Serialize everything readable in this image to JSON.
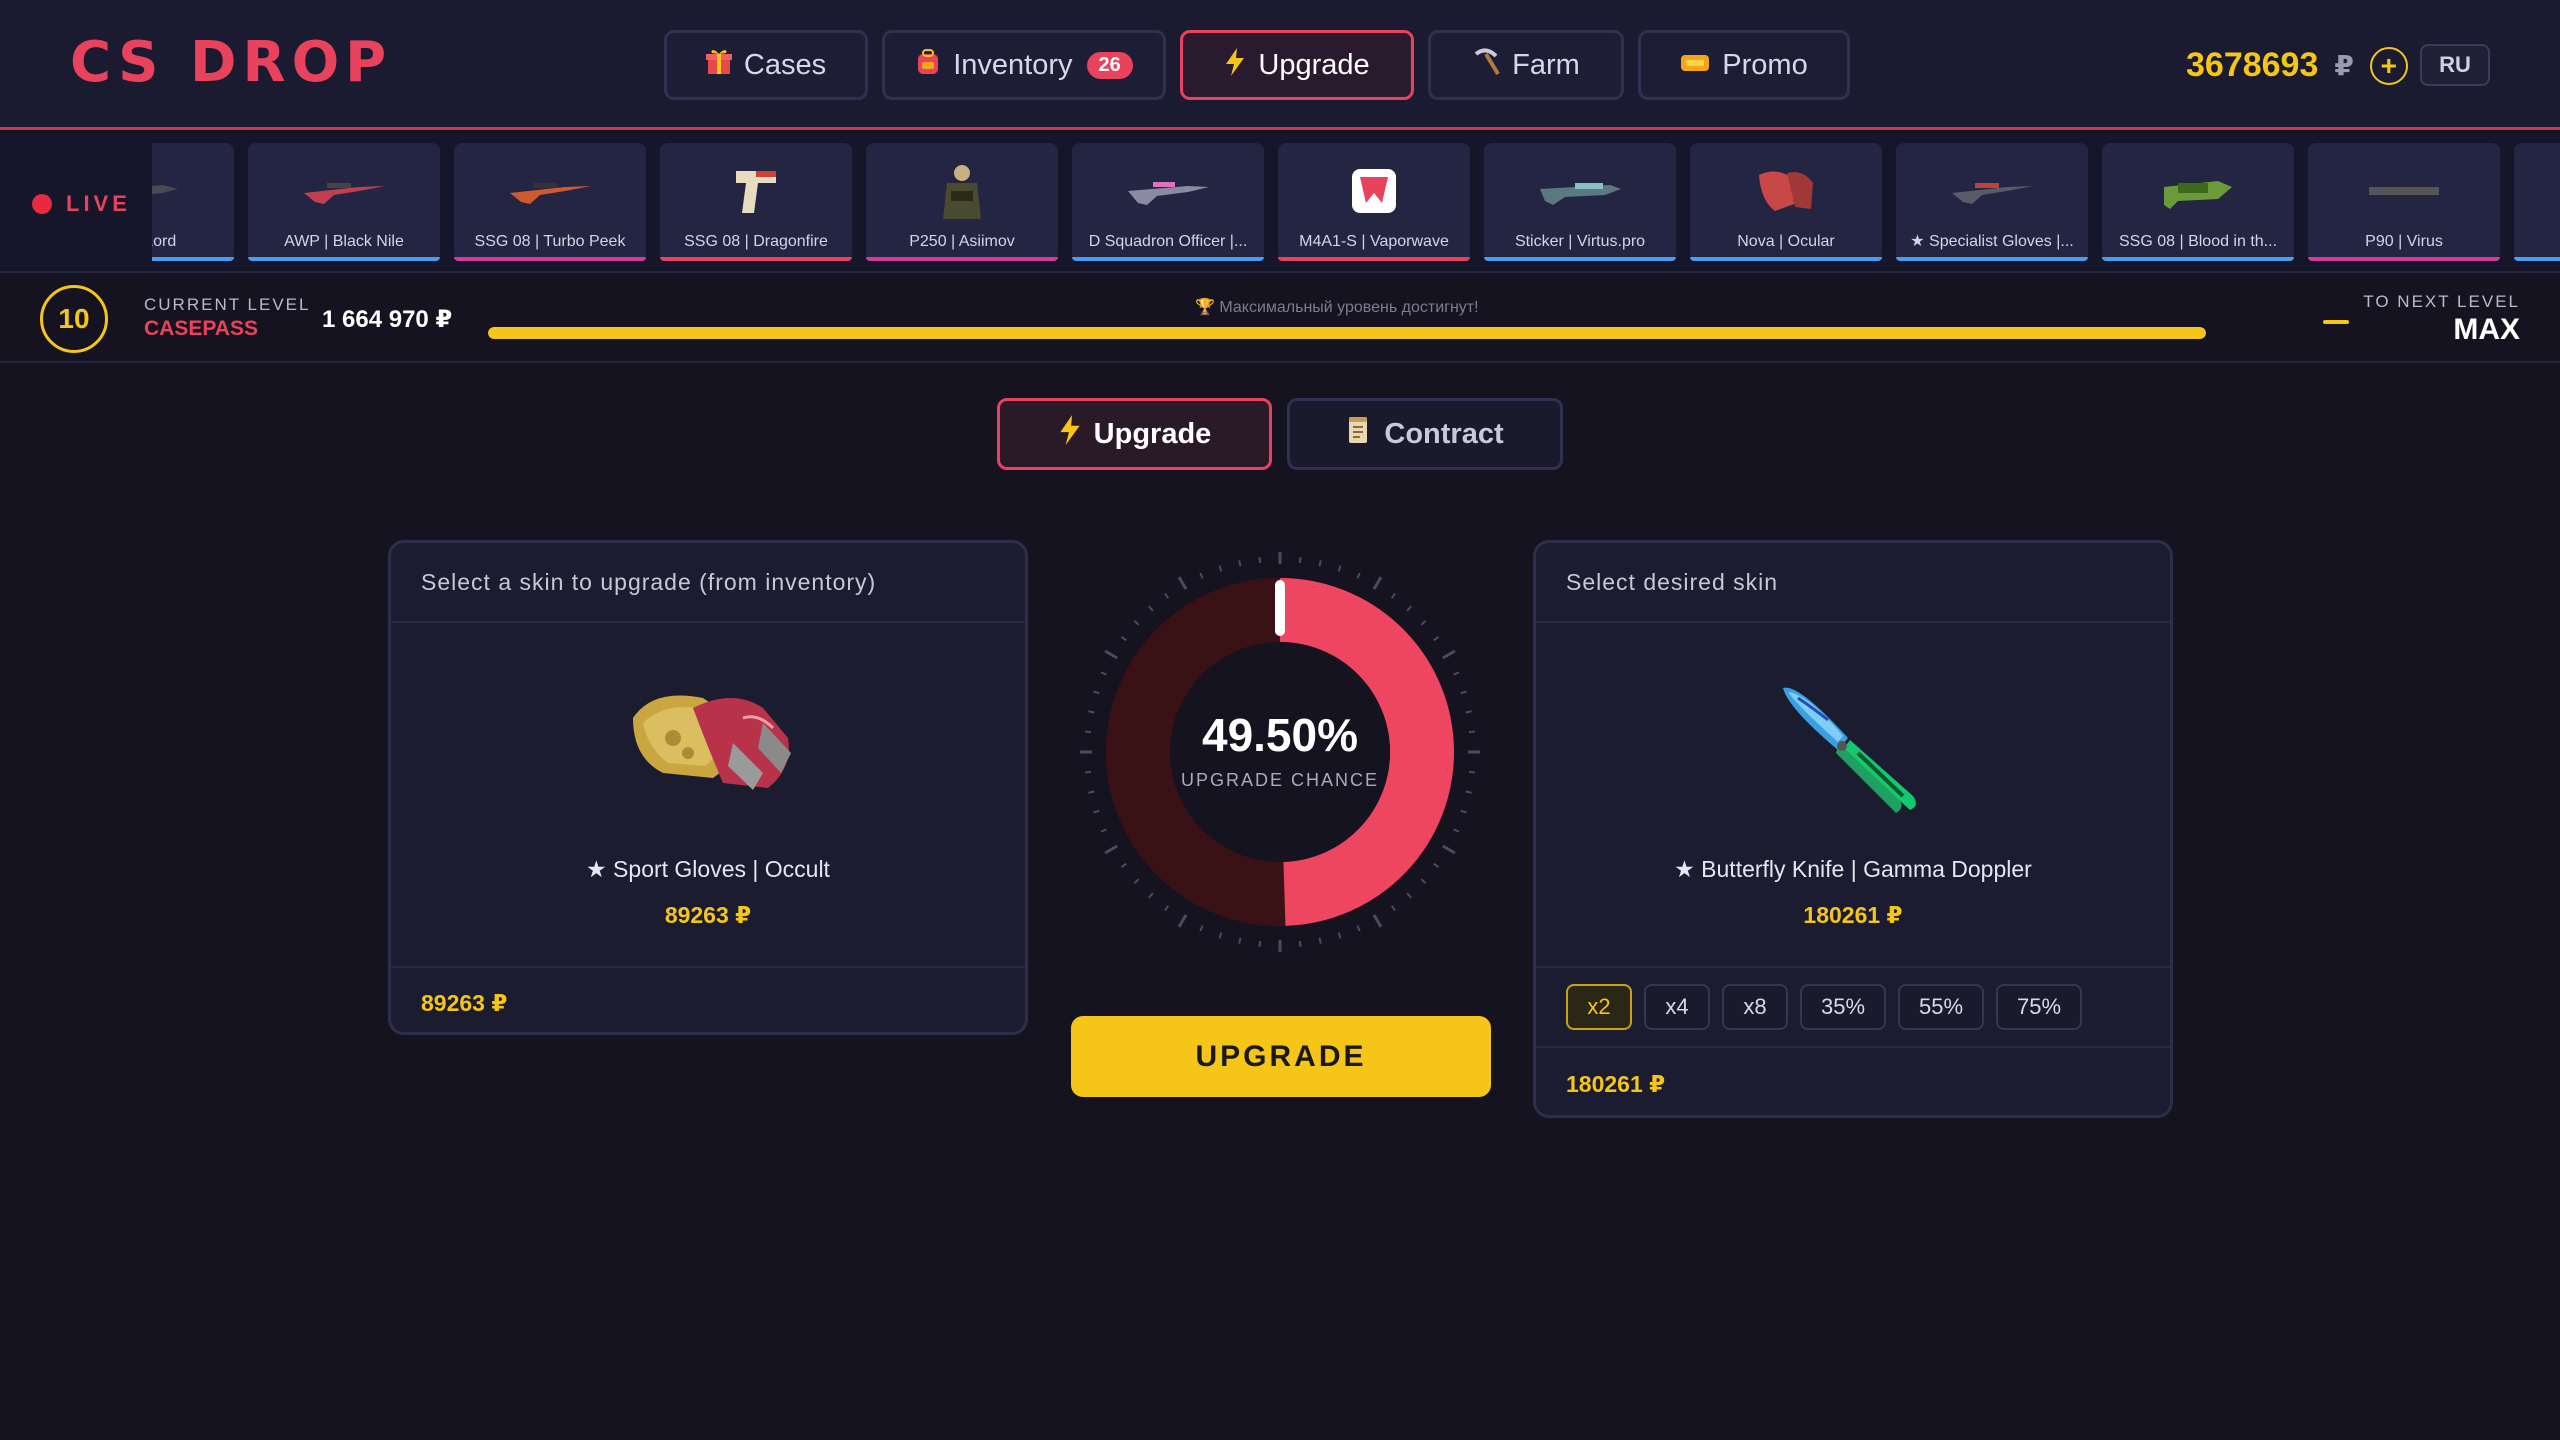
{
  "header": {
    "logo": "CS DROP",
    "nav": [
      {
        "label": "Cases",
        "icon": "gift-icon"
      },
      {
        "label": "Inventory",
        "icon": "backpack-icon",
        "badge": "26"
      },
      {
        "label": "Upgrade",
        "icon": "lightning-icon",
        "active": true
      },
      {
        "label": "Farm",
        "icon": "pickaxe-icon"
      },
      {
        "label": "Promo",
        "icon": "ticket-icon"
      }
    ],
    "balance": "3678693",
    "currency": "₽",
    "add_funds": "+",
    "language": "RU"
  },
  "live": {
    "label": "LIVE",
    "drops": [
      {
        "name": "Witch Lord",
        "color": "#4a9cf0"
      },
      {
        "name": "AWP | Black Nile",
        "color": "#4a9cf0"
      },
      {
        "name": "SSG 08 | Turbo Peek",
        "color": "#d33a9a"
      },
      {
        "name": "SSG 08 | Dragonfire",
        "color": "#e8425c"
      },
      {
        "name": "P250 | Asiimov",
        "color": "#d33a9a"
      },
      {
        "name": "D Squadron Officer |...",
        "color": "#4a9cf0"
      },
      {
        "name": "M4A1-S | Vaporwave",
        "color": "#e8425c"
      },
      {
        "name": "Sticker | Virtus.pro",
        "color": "#4a9cf0"
      },
      {
        "name": "Nova | Ocular",
        "color": "#4a9cf0"
      },
      {
        "name": "★ Specialist Gloves |...",
        "color": "#4a9cf0"
      },
      {
        "name": "SSG 08 | Blood in th...",
        "color": "#4a9cf0"
      },
      {
        "name": "P90 | Virus",
        "color": "#d33a9a"
      },
      {
        "name": "",
        "color": "#4a9cf0"
      }
    ]
  },
  "casepass": {
    "level": "10",
    "current_level_label": "CURRENT LEVEL",
    "name": "CASEPASS",
    "points": "1 664 970 ₽",
    "message": "🏆 Максимальный уровень достигнут!",
    "progress": 1.0,
    "next_level_label": "TO NEXT LEVEL",
    "next_level_value": "MAX"
  },
  "modes": [
    {
      "label": "Upgrade",
      "icon": "lightning-icon",
      "active": true
    },
    {
      "label": "Contract",
      "icon": "scroll-icon",
      "active": false
    }
  ],
  "left_panel": {
    "title": "Select a skin to upgrade (from inventory)",
    "skin_name": "★ Sport Gloves | Occult",
    "skin_price": "89263 ₽",
    "footer_total": "89263 ₽"
  },
  "gauge": {
    "chance": 0.495,
    "chance_text": "49.50%",
    "label": "UPGRADE CHANCE"
  },
  "upgrade_button": "UPGRADE",
  "right_panel": {
    "title": "Select desired skin",
    "skin_name": "★ Butterfly Knife | Gamma Doppler",
    "skin_price": "180261 ₽",
    "multipliers": [
      "x2",
      "x4",
      "x8",
      "35%",
      "55%",
      "75%"
    ],
    "active_multiplier": "x2",
    "footer_total": "180261 ₽"
  }
}
